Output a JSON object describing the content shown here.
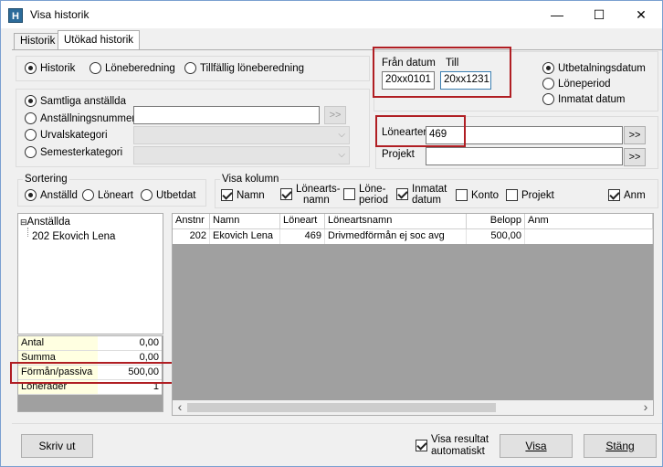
{
  "window": {
    "title": "Visa historik",
    "app_icon": "H",
    "minimize_glyph": "—",
    "maximize_glyph": "☐",
    "close_glyph": "✕"
  },
  "tabs": [
    {
      "label": "Historik"
    },
    {
      "label": "Utökad historik"
    }
  ],
  "mode_options": {
    "historik": "Historik",
    "loneberedning": "Löneberedning",
    "tillfallig": "Tillfällig löneberedning",
    "selected": "Historik"
  },
  "date_range": {
    "from_label": "Från datum",
    "to_label": "Till",
    "from_value": "20xx0101",
    "to_value": "20xx1231"
  },
  "date_type": {
    "utbetalning": "Utbetalningsdatum",
    "loneperiod": "Löneperiod",
    "inmatat": "Inmatat datum",
    "selected": "Utbetalningsdatum"
  },
  "employee_filter": {
    "samtliga": "Samtliga anställda",
    "anstallningsnummer": "Anställningsnummer",
    "urvalskategori": "Urvalskategori",
    "semesterkategori": "Semesterkategori",
    "selected": "Samtliga anställda",
    "browse_label": ">>",
    "dropdown_glyph": "⌵"
  },
  "loneart_filter": {
    "lonearter_label": "Lönearter",
    "lonearter_value": "469",
    "projekt_label": "Projekt",
    "projekt_value": "",
    "browse_label": ">>"
  },
  "sortering": {
    "title": "Sortering",
    "anstalld": "Anställd",
    "loneart": "Löneart",
    "utbetdat": "Utbetdat",
    "selected": "Anställd"
  },
  "visa_kolumn": {
    "title": "Visa kolumn",
    "namn": {
      "label": "Namn",
      "checked": true
    },
    "lonearts_namn": {
      "label_line1": "Lönearts-",
      "label_line2": "namn",
      "checked": true
    },
    "loneperiod": {
      "label_line1": "Löne-",
      "label_line2": "period",
      "checked": false
    },
    "inmatat_datum": {
      "label_line1": "Inmatat",
      "label_line2": "datum",
      "checked": true
    },
    "konto": {
      "label": "Konto",
      "checked": false
    },
    "projekt": {
      "label": "Projekt",
      "checked": false
    },
    "anm": {
      "label": "Anm",
      "checked": true
    }
  },
  "tree": {
    "root": "Anställda",
    "root_glyph": "⊟",
    "children": [
      "202 Ekovich Lena"
    ]
  },
  "summary": [
    {
      "label": "Antal",
      "value": "0,00"
    },
    {
      "label": "Summa",
      "value": "0,00"
    },
    {
      "label": "Förmån/passiva",
      "value": "500,00"
    },
    {
      "label": "Lönerader",
      "value": "1"
    }
  ],
  "grid": {
    "columns": [
      "Anstnr",
      "Namn",
      "Löneart",
      "Löneartsnamn",
      "Belopp",
      "Anm"
    ],
    "rows": [
      {
        "anstnr": "202",
        "namn": "Ekovich Lena",
        "loneart": "469",
        "loneartsnamn": "Drivmedförmån ej soc avg",
        "belopp": "500,00",
        "anm": ""
      }
    ],
    "scroll_left_glyph": "‹",
    "scroll_right_glyph": "›"
  },
  "footer": {
    "print_label": "Skriv ut",
    "auto_line1": "Visa resultat",
    "auto_line2": "automatiskt",
    "auto_checked": true,
    "visa_label": "Visa",
    "stang_label": "Stäng"
  },
  "colors": {
    "highlight_border": "#b01e23",
    "summary_label_bg": "#ffffe1",
    "grid_empty_bg": "#a0a0a0"
  }
}
